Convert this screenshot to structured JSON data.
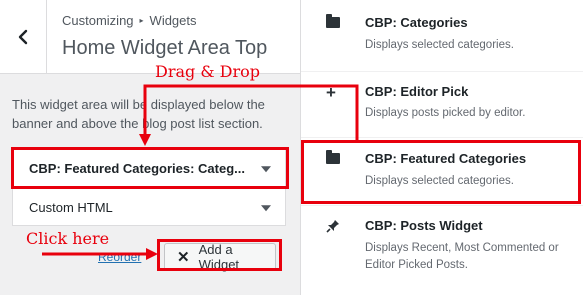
{
  "breadcrumb": {
    "root": "Customizing",
    "separator": "▸",
    "leaf": "Widgets"
  },
  "section_title": "Home Widget Area Top",
  "description": "This widget area will be displayed below the banner and above the blog post list section.",
  "widgets": [
    {
      "label": "CBP: Featured Categories: Categ..."
    },
    {
      "label": "Custom HTML"
    }
  ],
  "reorder_label": "Reorder",
  "add_widget_label": "Add a Widget",
  "available_widgets": [
    {
      "title": "CBP: Categories",
      "description": "Displays selected categories.",
      "icon": "folder-icon"
    },
    {
      "title": "CBP: Editor Pick",
      "description": "Displays posts picked by editor.",
      "icon": "plus-icon"
    },
    {
      "title": "CBP: Featured Categories",
      "description": "Displays selected categories.",
      "icon": "folder-icon"
    },
    {
      "title": "CBP: Posts Widget",
      "description": "Displays Recent, Most Commented or Editor Picked Posts.",
      "icon": "pin-icon"
    }
  ],
  "annotations": {
    "drag_drop": "Drag & Drop",
    "click_here": "Click here"
  },
  "colors": {
    "annotation_red": "#e8000d",
    "link_blue": "#2271b1"
  }
}
